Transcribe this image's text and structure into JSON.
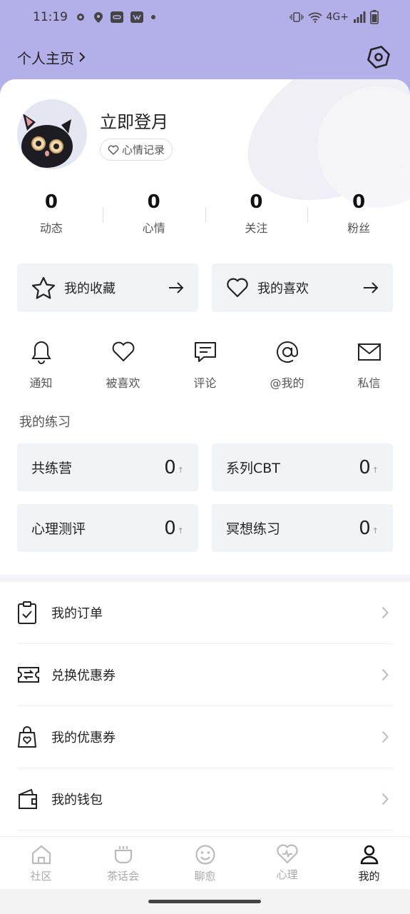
{
  "status_bar": {
    "time": "11:19",
    "network": "4G+"
  },
  "header": {
    "title": "个人主页"
  },
  "profile": {
    "username": "立即登月",
    "mood_label": "心情记录"
  },
  "stats": [
    {
      "value": "0",
      "label": "动态"
    },
    {
      "value": "0",
      "label": "心情"
    },
    {
      "value": "0",
      "label": "关注"
    },
    {
      "value": "0",
      "label": "粉丝"
    }
  ],
  "favorites": [
    {
      "label": "我的收藏",
      "icon": "star-icon"
    },
    {
      "label": "我的喜欢",
      "icon": "heart-icon"
    }
  ],
  "quick": [
    {
      "label": "通知",
      "icon": "bell-icon"
    },
    {
      "label": "被喜欢",
      "icon": "heart-outline-icon"
    },
    {
      "label": "评论",
      "icon": "comment-icon"
    },
    {
      "label": "@我的",
      "icon": "at-icon"
    },
    {
      "label": "私信",
      "icon": "mail-icon"
    }
  ],
  "practice": {
    "title": "我的练习",
    "items": [
      {
        "label": "共练营",
        "value": "0"
      },
      {
        "label": "系列CBT",
        "value": "0"
      },
      {
        "label": "心理测评",
        "value": "0"
      },
      {
        "label": "冥想练习",
        "value": "0"
      }
    ]
  },
  "menu": [
    {
      "label": "我的订单",
      "icon": "clipboard-check-icon"
    },
    {
      "label": "兑换优惠券",
      "icon": "ticket-exchange-icon"
    },
    {
      "label": "我的优惠券",
      "icon": "shopping-bag-heart-icon"
    },
    {
      "label": "我的钱包",
      "icon": "wallet-icon"
    }
  ],
  "tabs": [
    {
      "label": "社区",
      "icon": "home-icon"
    },
    {
      "label": "茶话会",
      "icon": "cup-icon"
    },
    {
      "label": "聊愈",
      "icon": "smile-icon"
    },
    {
      "label": "心理",
      "icon": "heart-pulse-icon"
    },
    {
      "label": "我的",
      "icon": "person-icon",
      "active": true
    }
  ],
  "colors": {
    "header_bg": "#b3afe8",
    "card_bg": "#f2f3f5",
    "text_primary": "#222222",
    "text_secondary": "#555555",
    "tab_inactive": "#aaaaaa"
  }
}
